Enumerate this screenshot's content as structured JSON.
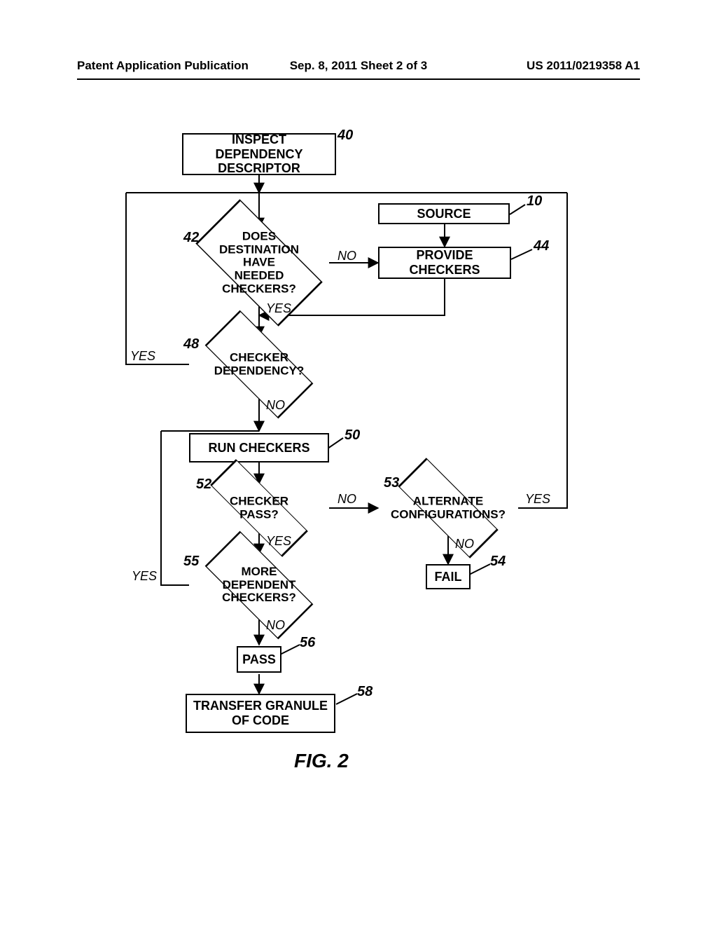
{
  "header": {
    "left": "Patent Application Publication",
    "mid": "Sep. 8, 2011   Sheet 2 of 3",
    "right": "US 2011/0219358 A1"
  },
  "refs": {
    "r40": "40",
    "r10": "10",
    "r42": "42",
    "r44": "44",
    "r48": "48",
    "r50": "50",
    "r52": "52",
    "r53": "53",
    "r54": "54",
    "r55": "55",
    "r56": "56",
    "r58": "58"
  },
  "nodes": {
    "inspect": "INSPECT DEPENDENCY\nDESCRIPTOR",
    "source": "SOURCE",
    "provide": "PROVIDE CHECKERS",
    "dest_check": "DOES\nDESTINATION\nHAVE NEEDED\nCHECKERS?",
    "checker_dep": "CHECKER\nDEPENDENCY?",
    "run": "RUN CHECKERS",
    "pass_q": "CHECKER PASS?",
    "alt": "ALTERNATE\nCONFIGURATIONS?",
    "more": "MORE\nDEPENDENT\nCHECKERS?",
    "fail": "FAIL",
    "pass": "PASS",
    "transfer": "TRANSFER GRANULE\nOF CODE"
  },
  "labels": {
    "yes": "YES",
    "no": "NO"
  },
  "figure": "FIG. 2"
}
